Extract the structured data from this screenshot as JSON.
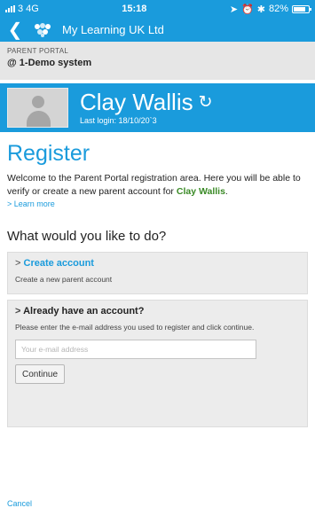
{
  "status_bar": {
    "carrier": "3",
    "network": "4G",
    "time": "15:18",
    "battery": "82%",
    "battery_level": 0.82
  },
  "app_bar": {
    "back_icon": "chevron-left-icon",
    "app_icon": "app-logo-icon",
    "title": "My Learning UK Ltd"
  },
  "portal": {
    "label": "PARENT PORTAL",
    "system": "@ 1-Demo system"
  },
  "user": {
    "name": "Clay Wallis",
    "last_login_label": "Last login:",
    "last_login_value": "18/10/20`3",
    "refresh_icon": "refresh-icon",
    "avatar_icon": "user-avatar-icon"
  },
  "register": {
    "title": "Register",
    "intro_text": "Welcome to the Parent Portal registration area. Here you will be able to verify or create a new parent account for",
    "intro_name": "Clay Wallis",
    "intro_end": ".",
    "learn_more": "> Learn more"
  },
  "question": "What would you like to do?",
  "create_card": {
    "arrow": ">",
    "title": "Create account",
    "subtitle": "Create a new parent account"
  },
  "existing_card": {
    "arrow": ">",
    "title": "Already have an account?",
    "subtitle": "Please enter the e-mail address you used to register and click continue.",
    "email_placeholder": "Your e-mail address",
    "email_value": "",
    "continue_label": "Continue"
  },
  "cancel_label": "Cancel",
  "colors": {
    "accent": "#1a9bdc",
    "name_green": "#3a8a26",
    "card_bg": "#ececec"
  }
}
